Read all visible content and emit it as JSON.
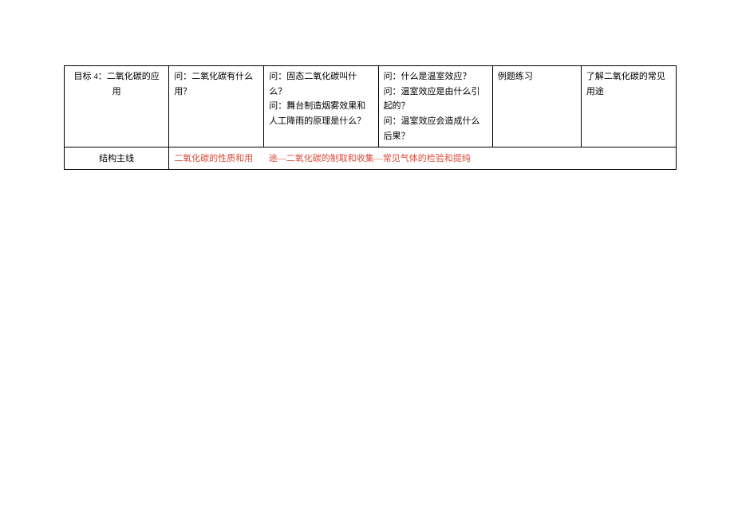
{
  "table": {
    "row1": {
      "col1": "目标 4：二氧化碳的应用",
      "col2": "问：二氧化碳有什么用？",
      "col3": "问：固态二氧化碳叫什么？\n问：舞台制造烟雾效果和人工降雨的原理是什么？",
      "col4": "问：什么是温室效应？\n问：温室效应是由什么引起的？\n问：温室效应会造成什么后果？",
      "col5": "例题练习",
      "col6": "了解二氧化碳的常见用途"
    },
    "row2": {
      "label": "结构主线",
      "content_part1": "二氧化碳的性质和用",
      "content_part2": "途—二氧化碳的制取和收集—常见气体的检验和提纯"
    }
  }
}
